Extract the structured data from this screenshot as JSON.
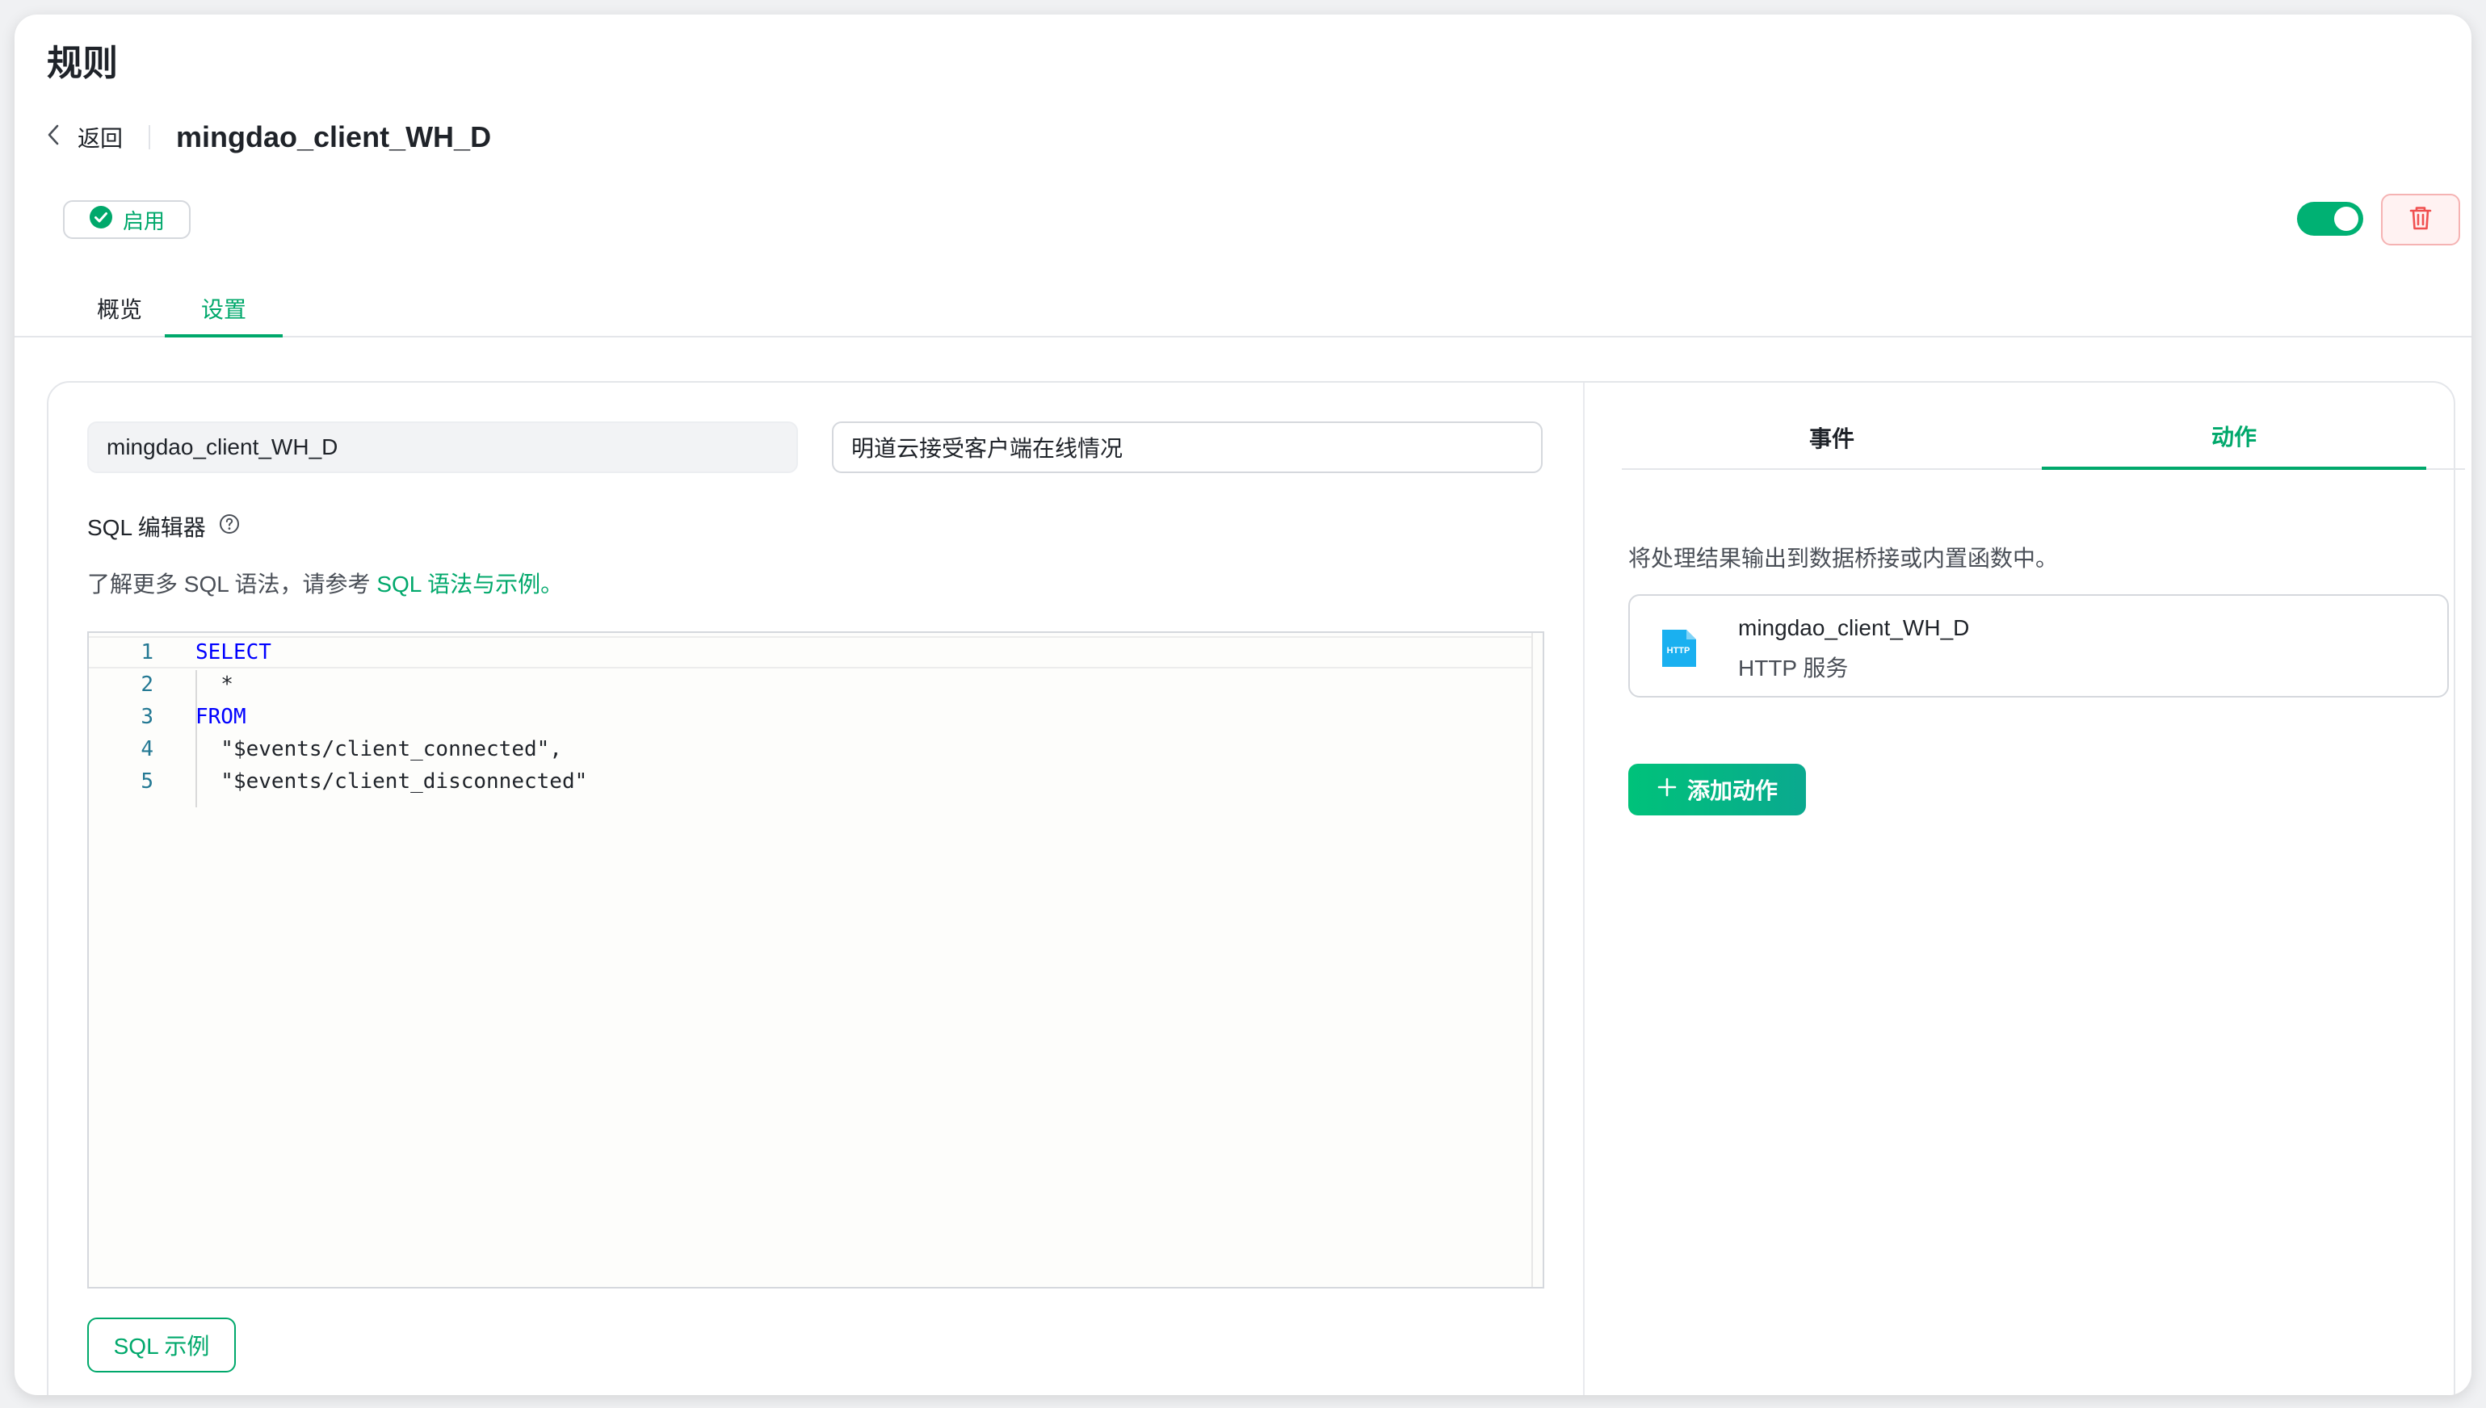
{
  "page": {
    "title": "规则"
  },
  "header": {
    "back_label": "返回",
    "rule_name": "mingdao_client_WH_D"
  },
  "status": {
    "label": "启用",
    "enabled": true,
    "accent_color": "#00a86b"
  },
  "main_tabs": [
    {
      "label": "概览",
      "active": false
    },
    {
      "label": "设置",
      "active": true
    }
  ],
  "form": {
    "name_value": "mingdao_client_WH_D",
    "description_value": "明道云接受客户端在线情况",
    "sql_label": "SQL 编辑器",
    "sql_help_prefix": "了解更多 SQL 语法，请参考 ",
    "sql_help_link": "SQL 语法与示例。",
    "sql_example_button": "SQL 示例"
  },
  "sql_editor": {
    "lines": [
      {
        "no": "1",
        "text": "SELECT",
        "kind": "keyword"
      },
      {
        "no": "2",
        "text": "  *",
        "kind": "plain"
      },
      {
        "no": "3",
        "text": "FROM",
        "kind": "keyword"
      },
      {
        "no": "4",
        "text": "  \"$events/client_connected\",",
        "kind": "plain"
      },
      {
        "no": "5",
        "text": "  \"$events/client_disconnected\"",
        "kind": "plain"
      }
    ]
  },
  "right_panel": {
    "tabs": [
      {
        "label": "事件",
        "active": false
      },
      {
        "label": "动作",
        "active": true
      }
    ],
    "description": "将处理结果输出到数据桥接或内置函数中。",
    "action": {
      "name": "mingdao_client_WH_D",
      "type": "HTTP 服务",
      "icon": "http-file-icon",
      "icon_text": "HTTP"
    },
    "add_action_label": "添加动作"
  },
  "colors": {
    "accent": "#00a86b",
    "danger": "#f05050",
    "http_icon": "#1ab0f0"
  }
}
